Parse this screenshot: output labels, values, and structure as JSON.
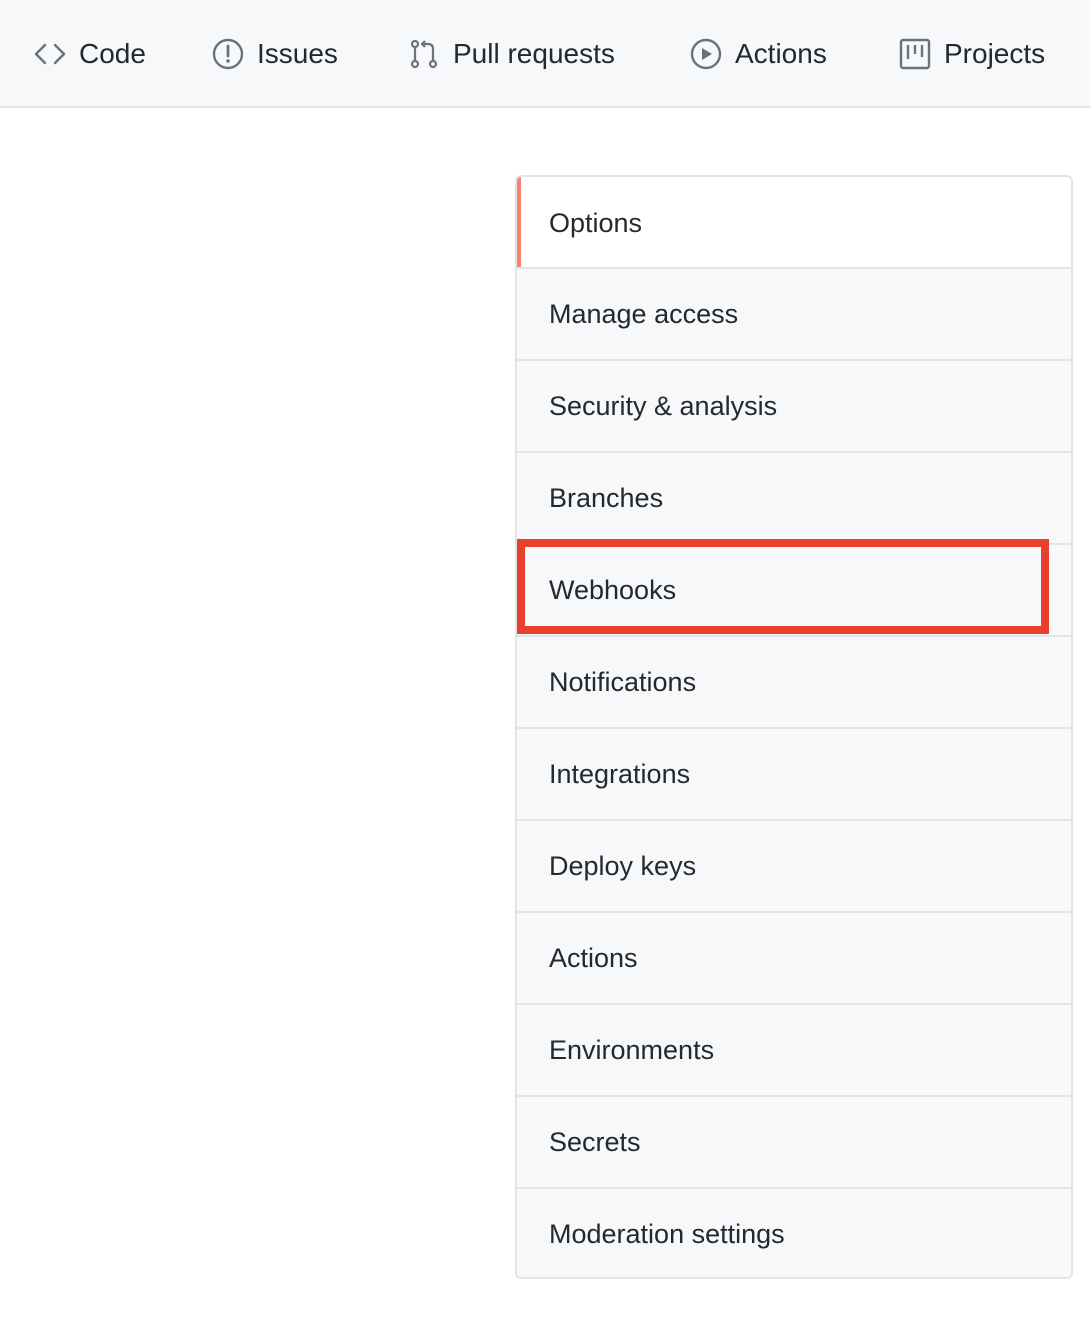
{
  "repo_nav": {
    "tabs": [
      {
        "label": "Code",
        "icon": "code-icon"
      },
      {
        "label": "Issues",
        "icon": "issue-opened-icon"
      },
      {
        "label": "Pull requests",
        "icon": "git-pull-request-icon"
      },
      {
        "label": "Actions",
        "icon": "play-icon"
      },
      {
        "label": "Projects",
        "icon": "project-icon"
      }
    ]
  },
  "settings_menu": {
    "selected": "Options",
    "highlighted": "Webhooks",
    "highlight_color": "#e8402c",
    "selected_indicator_color": "#f9826c",
    "items": [
      {
        "label": "Options"
      },
      {
        "label": "Manage access"
      },
      {
        "label": "Security & analysis"
      },
      {
        "label": "Branches"
      },
      {
        "label": "Webhooks"
      },
      {
        "label": "Notifications"
      },
      {
        "label": "Integrations"
      },
      {
        "label": "Deploy keys"
      },
      {
        "label": "Actions"
      },
      {
        "label": "Environments"
      },
      {
        "label": "Secrets"
      },
      {
        "label": "Moderation settings"
      }
    ]
  }
}
